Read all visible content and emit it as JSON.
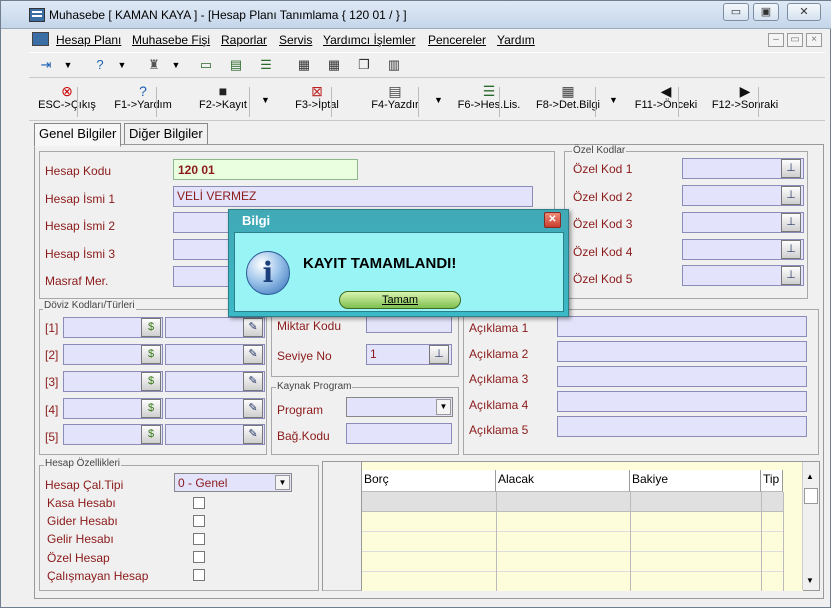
{
  "window": {
    "title": "Muhasebe [ KAMAN KAYA ]  - [Hesap Planı Tanımlama { 120 01 / } ]"
  },
  "title_buttons": {
    "minimize": "▭",
    "restore": "▣",
    "close": "✕"
  },
  "mdi_buttons": {
    "minimize": "–",
    "restore": "▭",
    "close": "×"
  },
  "menu": [
    "Hesap Planı",
    "Muhasebe Fişi",
    "Raporlar",
    "Servis",
    "Yardımcı İşlemler",
    "Pencereler",
    "Yardım"
  ],
  "toolbar2": [
    {
      "label": "ESC->Çıkış",
      "icon": "⊗"
    },
    {
      "label": "F1->Yardım",
      "icon": "?"
    },
    {
      "label": "F2->Kayıt",
      "icon": "■"
    },
    {
      "label": "F3->İptal",
      "icon": "⊠"
    },
    {
      "label": "F4-Yazdır",
      "icon": "▤"
    },
    {
      "label": "F6->Hes.Lis.",
      "icon": "☰"
    },
    {
      "label": "F8->Det.Bilgi",
      "icon": "▦"
    },
    {
      "label": "F11->Önceki",
      "icon": "◀"
    },
    {
      "label": "F12->Sonraki",
      "icon": "▶"
    }
  ],
  "tabs": {
    "genel": "Genel Bilgiler",
    "diger": "Diğer Bilgiler"
  },
  "form": {
    "hesap_kodu_label": "Hesap Kodu",
    "hesap_kodu_value": "120 01",
    "hesap_ismi1_label": "Hesap İsmi 1",
    "hesap_ismi1_value": "VELİ VERMEZ",
    "hesap_ismi2_label": "Hesap İsmi 2",
    "hesap_ismi3_label": "Hesap İsmi 3",
    "masraf_label": "Masraf Mer."
  },
  "ozel_kodlar": {
    "title": "Özel Kodlar",
    "items": [
      "Özel Kod 1",
      "Özel Kod 2",
      "Özel Kod 3",
      "Özel Kod 4",
      "Özel Kod 5"
    ]
  },
  "doviz": {
    "title": "Döviz Kodları/Türleri",
    "rows": [
      "[1]",
      "[2]",
      "[3]",
      "[4]",
      "[5]"
    ]
  },
  "miktar": {
    "miktar_label": "Miktar Kodu",
    "seviye_label": "Seviye No",
    "seviye_value": "1"
  },
  "kaynak": {
    "title": "Kaynak Program",
    "program_label": "Program",
    "bag_label": "Bağ.Kodu"
  },
  "aciklama": [
    "Açıklama 1",
    "Açıklama 2",
    "Açıklama 3",
    "Açıklama 4",
    "Açıklama 5"
  ],
  "ozellikler": {
    "title": "Hesap Özellikleri",
    "cal_tipi_label": "Hesap Çal.Tipi",
    "cal_tipi_value": "0 - Genel",
    "checks": [
      "Kasa Hesabı",
      "Gider Hesabı",
      "Gelir Hesabı",
      "Özel Hesap",
      "Çalışmayan Hesap"
    ]
  },
  "grid": {
    "columns": [
      "Borç",
      "Alacak",
      "Bakiye",
      "Tip"
    ]
  },
  "dialog": {
    "title": "Bilgi",
    "message": "KAYIT TAMAMLANDI!",
    "button": "Tamam",
    "close": "✕",
    "icon": "i"
  },
  "colors": {
    "dialog": "#3ab9c6",
    "dialog_body": "#99f4f6",
    "field": "#e3e3fb",
    "label": "#8b1a1a",
    "grid_row": "#fdfddc"
  }
}
